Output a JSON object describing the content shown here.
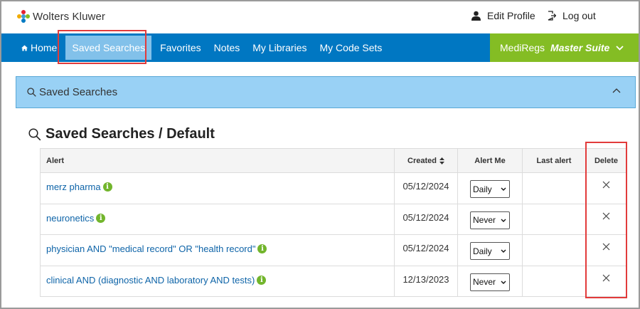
{
  "brand": {
    "name": "Wolters Kluwer"
  },
  "top_links": {
    "profile": "Edit Profile",
    "logout": "Log out"
  },
  "nav": {
    "items": [
      "Home",
      "Saved Searches",
      "Favorites",
      "Notes",
      "My Libraries",
      "My Code Sets"
    ],
    "active": "Saved Searches",
    "product": {
      "brand": "MediRegs",
      "suite": "Master Suite"
    }
  },
  "panel": {
    "title": "Saved Searches"
  },
  "section": {
    "title": "Saved Searches / Default"
  },
  "table": {
    "headers": {
      "alert": "Alert",
      "created": "Created",
      "alert_me": "Alert Me",
      "last_alert": "Last alert",
      "delete": "Delete"
    },
    "rows": [
      {
        "alert": "merz pharma",
        "created": "05/12/2024",
        "alert_me": "Daily",
        "last_alert": ""
      },
      {
        "alert": "neuronetics",
        "created": "05/12/2024",
        "alert_me": "Never",
        "last_alert": ""
      },
      {
        "alert": "physician AND \"medical record\" OR \"health record\"",
        "created": "05/12/2024",
        "alert_me": "Daily",
        "last_alert": ""
      },
      {
        "alert": "clinical AND (diagnostic AND laboratory AND tests)",
        "created": "12/13/2023",
        "alert_me": "Never",
        "last_alert": ""
      }
    ]
  },
  "info_glyph": "i",
  "delete_glyph": "✕",
  "icons": {
    "logo": "wolters-kluwer-logo",
    "profile": "user-icon",
    "logout": "log-out-icon",
    "home": "home-icon",
    "search": "search-icon",
    "chevron": "chevron-down-icon",
    "collapse": "chevron-up-icon",
    "sort": "sort-icon",
    "info": "info-icon",
    "delete": "close-icon"
  },
  "colors": {
    "nav": "#0077c2",
    "nav_active": "#82c1ea",
    "product": "#84bd24",
    "panel": "#99d1f5",
    "link": "#0e64a8",
    "info": "#72b52c",
    "highlight": "#e23b3b"
  }
}
